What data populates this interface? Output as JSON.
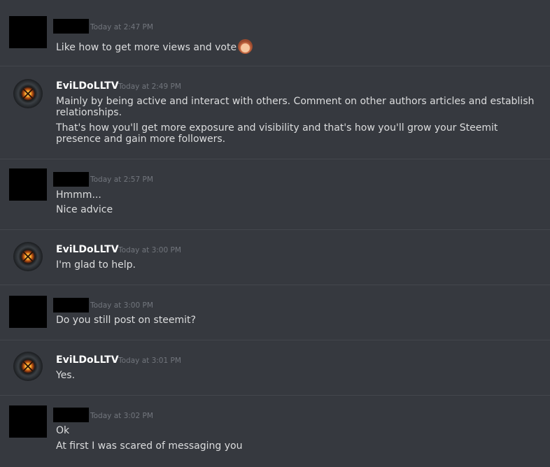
{
  "messages": [
    {
      "author": "",
      "time": "Today at 2:47 PM",
      "lines": [
        "Like how to get more views and vote"
      ],
      "emoji": "see-no-evil-monkey"
    },
    {
      "author": "EviLDoLLTV",
      "time": "Today at 2:49 PM",
      "lines": [
        "Mainly by being active and interact with others. Comment on other authors articles and establish relationships.",
        "That's how you'll get more exposure and visibility and that's how you'll grow your Steemit presence and gain more followers."
      ]
    },
    {
      "author": "",
      "time": "Today at 2:57 PM",
      "lines": [
        "Hmmm...",
        "Nice advice"
      ]
    },
    {
      "author": "EviLDoLLTV",
      "time": "Today at 3:00 PM",
      "lines": [
        "I'm glad to help."
      ]
    },
    {
      "author": "",
      "time": "Today at 3:00 PM",
      "lines": [
        "Do you still post on steemit?"
      ]
    },
    {
      "author": "EviLDoLLTV",
      "time": "Today at 3:01 PM",
      "lines": [
        "Yes."
      ]
    },
    {
      "author": "",
      "time": "Today at 3:02 PM",
      "lines": [
        "Ok",
        "At first I was scared of messaging you"
      ]
    }
  ]
}
